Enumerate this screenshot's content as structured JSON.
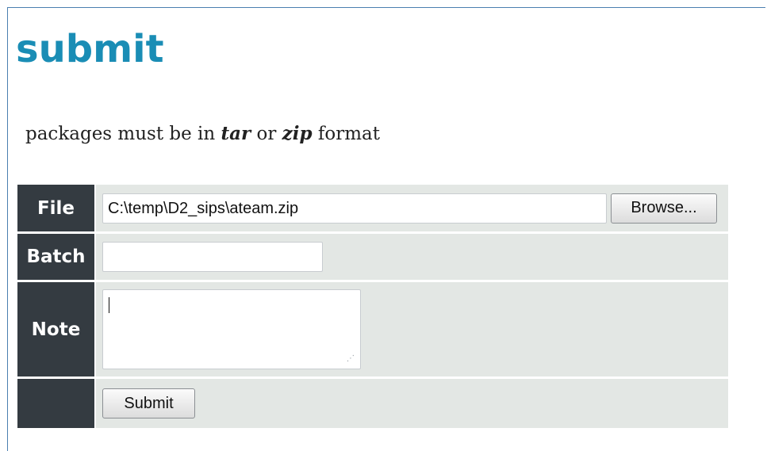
{
  "page": {
    "title": "submit",
    "intro_prefix": "packages must be in ",
    "intro_tar": "tar",
    "intro_or": " or ",
    "intro_zip": "zip",
    "intro_suffix": " format"
  },
  "form": {
    "file": {
      "label": "File",
      "value": "C:\\temp\\D2_sips\\ateam.zip",
      "browse_label": "Browse..."
    },
    "batch": {
      "label": "Batch",
      "value": ""
    },
    "note": {
      "label": "Note",
      "value": ""
    },
    "submit_label": "Submit"
  },
  "colors": {
    "title": "#1a8db5",
    "label_bg": "#343b41",
    "field_bg": "#e3e7e4",
    "frame_border": "#4a7fb0"
  },
  "icons": {
    "resize_grip": "resize-grip-icon"
  }
}
